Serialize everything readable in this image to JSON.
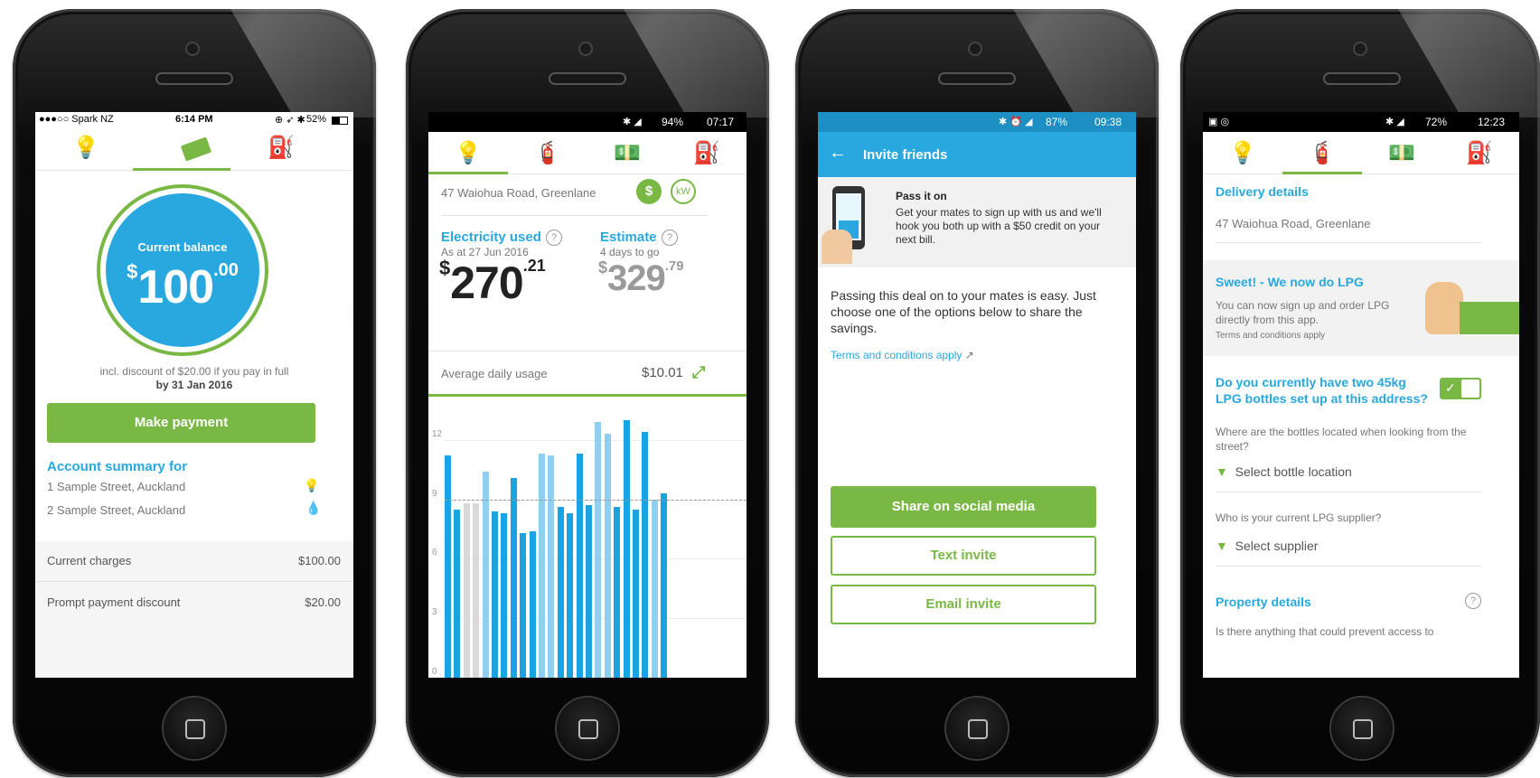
{
  "colors": {
    "accent_green": "#7ab845",
    "accent_blue": "#29a8e0",
    "bar_dark": "#1aa3e3",
    "bar_light": "#8fd0f1",
    "bar_grey": "#d9d9d9"
  },
  "phone1": {
    "status": {
      "carrier": "●●●○○ Spark NZ",
      "time": "6:14 PM",
      "battery": "52%"
    },
    "tabs": [
      "bulb-icon",
      "cash-icon",
      "gas-icon"
    ],
    "balance_label": "Current balance",
    "balance_currency": "$",
    "balance_whole": "100",
    "balance_cents": ".00",
    "discount_note": "incl. discount of $20.00 if you pay in full",
    "due_date": "by 31 Jan 2016",
    "make_payment": "Make payment",
    "account_summary_title": "Account summary for",
    "accounts": [
      {
        "address": "1 Sample Street, Auckland",
        "icon": "bulb-icon"
      },
      {
        "address": "2 Sample Street, Auckland",
        "icon": "gas-drop-icon"
      }
    ],
    "charges": [
      {
        "label": "Current charges",
        "amount": "$100.00"
      },
      {
        "label": "Prompt payment discount",
        "amount": "$20.00"
      }
    ]
  },
  "phone2": {
    "status": {
      "battery": "94%",
      "time": "07:17"
    },
    "address": "47 Waiohua Road, Greenlane",
    "toggle_dollar": "$",
    "toggle_kw": "kW",
    "electricity_label": "Electricity used",
    "electricity_date": "As at 27 Jun 2016",
    "electricity_currency": "$",
    "electricity_whole": "270",
    "electricity_cents": ".21",
    "estimate_label": "Estimate",
    "estimate_sub": "4 days to go",
    "estimate_currency": "$",
    "estimate_whole": "329",
    "estimate_cents": ".79",
    "avg_label": "Average daily usage",
    "avg_value": "$10.01"
  },
  "chart_data": {
    "type": "bar",
    "ylim": [
      0,
      13.5
    ],
    "yticks": [
      "12",
      "9",
      "6",
      "3",
      "0"
    ],
    "average_line": 9,
    "values": [
      11.2,
      8.5,
      8.8,
      8.8,
      10.4,
      8.4,
      8.3,
      10.1,
      7.3,
      7.4,
      11.3,
      11.2,
      8.6,
      8.3,
      11.3,
      8.7,
      12.9,
      12.3,
      8.6,
      13.0,
      8.5,
      12.4,
      9.0,
      9.3
    ],
    "kinds": [
      "dark",
      "dark",
      "grey",
      "grey",
      "light",
      "dark",
      "dark",
      "dark",
      "dark",
      "dark",
      "light",
      "light",
      "dark",
      "dark",
      "dark",
      "dark",
      "light",
      "light",
      "dark",
      "dark",
      "dark",
      "dark",
      "light",
      "dark"
    ]
  },
  "phone3": {
    "status": {
      "battery": "87%",
      "time": "09:38"
    },
    "title": "Invite friends",
    "promo_title": "Pass it on",
    "promo_body": "Get your mates to sign up with us and we'll hook you both up with a $50 credit on your next bill.",
    "body": "Passing this deal on to your mates is easy. Just choose one of the options below to share the savings.",
    "terms": "Terms and conditions apply",
    "share_social": "Share on social media",
    "text_invite": "Text invite",
    "email_invite": "Email invite"
  },
  "phone4": {
    "status": {
      "battery": "72%",
      "time": "12:23"
    },
    "delivery_title": "Delivery details",
    "delivery_address": "47 Waiohua Road, Greenlane",
    "lpg_title": "Sweet! - We now do LPG",
    "lpg_body": "You can now sign up and order LPG directly from this app.",
    "lpg_terms": "Terms and conditions apply",
    "question": "Do you currently have two 45kg LPG bottles set up at this address?",
    "location_q": "Where are the bottles located when looking from the street?",
    "location_select": "Select bottle location",
    "supplier_q": "Who is your current LPG supplier?",
    "supplier_select": "Select supplier",
    "property_title": "Property details",
    "property_q": "Is there anything that could prevent access to"
  }
}
